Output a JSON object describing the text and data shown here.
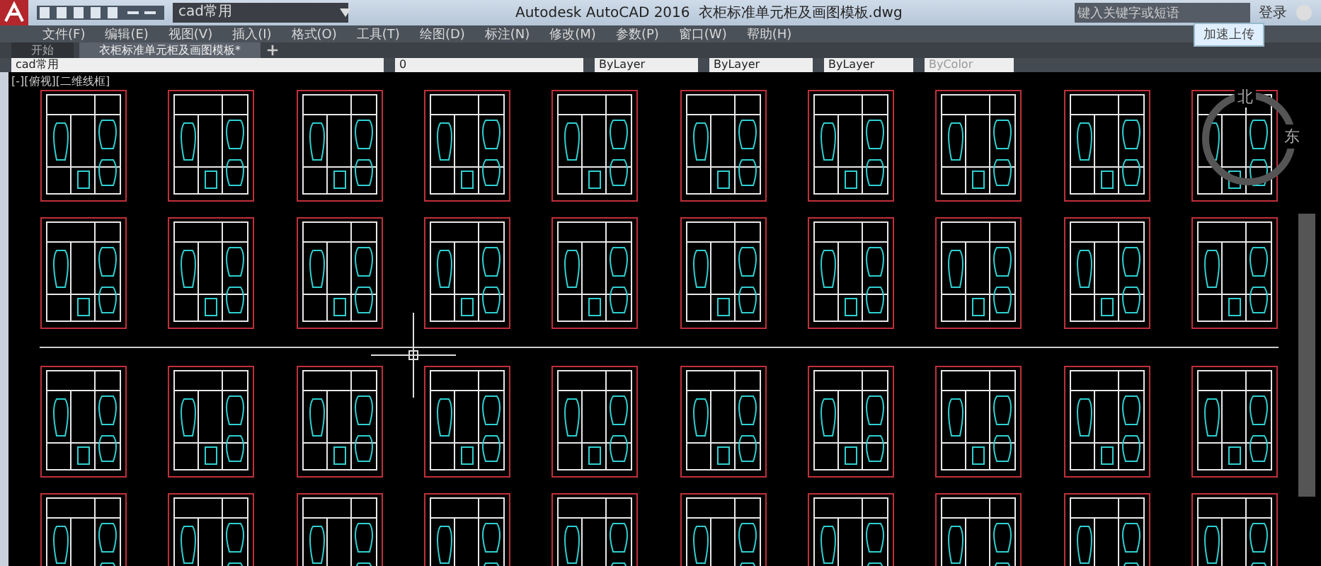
{
  "window": {
    "quick_access_workspace": "cad常用",
    "app_title": "Autodesk AutoCAD 2016",
    "file_title": "衣柜标准单元柜及画图模板.dwg",
    "search": {
      "placeholder": "键入关键字或短语"
    },
    "sign_in": "登录",
    "tooltip": "加速上传"
  },
  "menu": [
    "文件(F)",
    "编辑(E)",
    "视图(V)",
    "插入(I)",
    "格式(O)",
    "工具(T)",
    "绘图(D)",
    "标注(N)",
    "修改(M)",
    "参数(P)",
    "窗口(W)",
    "帮助(H)"
  ],
  "tabs": [
    {
      "label": "开始",
      "selected": false
    },
    {
      "label": "衣柜标准单元柜及画图模板*",
      "selected": true
    }
  ],
  "properties": {
    "workspace": "cad常用",
    "layer": "0",
    "color_setting": "ByLayer",
    "linetype": "ByLayer",
    "lineweight": "ByLayer",
    "plot_style": "ByColor"
  },
  "viewport_label": "[-][俯视][二维线框]",
  "viewcube": {
    "north": "北",
    "east": "东"
  }
}
